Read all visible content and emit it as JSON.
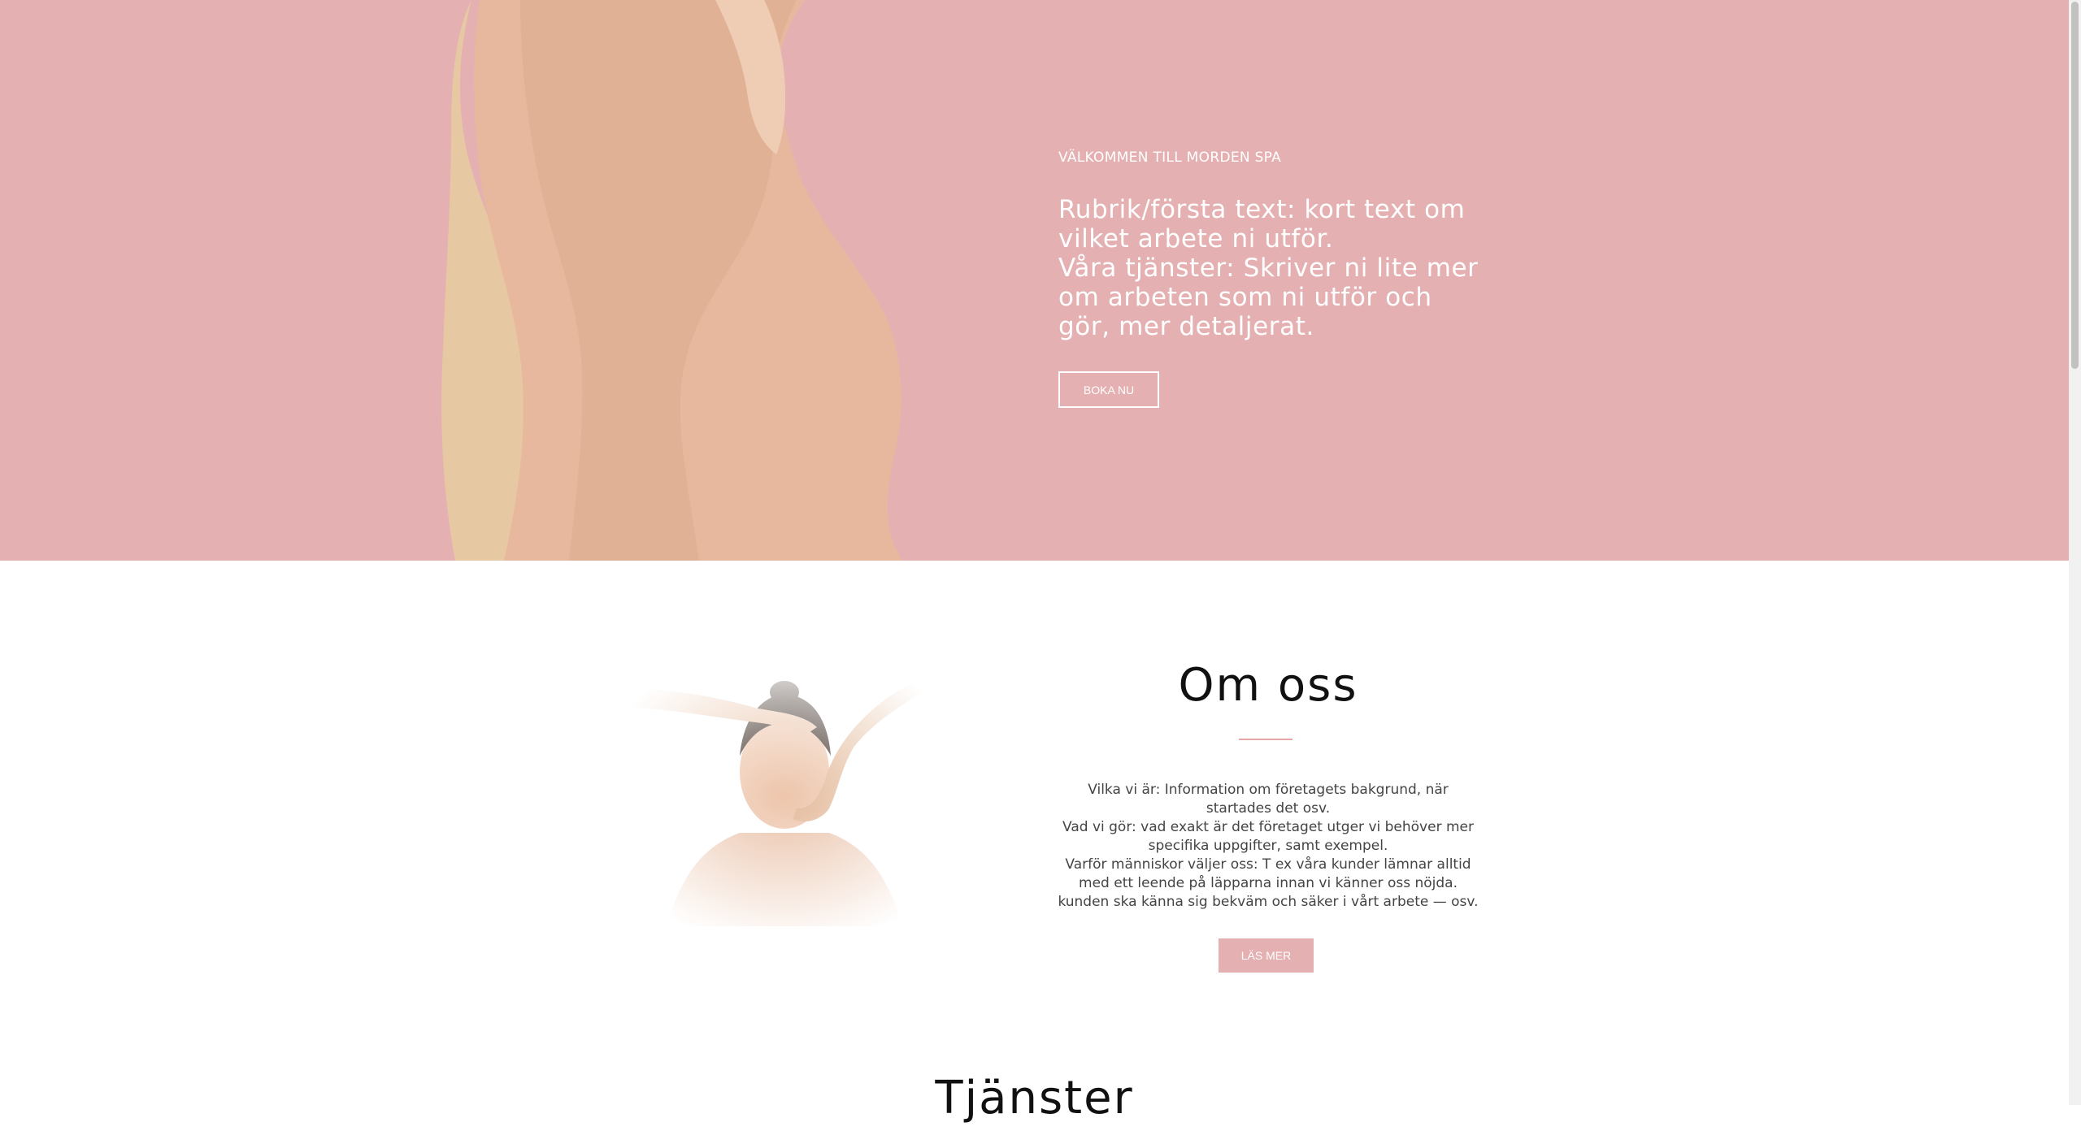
{
  "hero": {
    "welcome": "VÄLKOMMEN TILL MORDEN SPA",
    "lines": [
      "Rubrik/första text: kort text om vilket arbete ni utför.",
      "Våra tjänster: Skriver ni lite mer om arbeten som ni utför och gör, mer detaljerat."
    ],
    "button_label": "BOKA NU"
  },
  "about": {
    "title": "Om oss",
    "paragraphs": [
      "Vilka vi är: Information om företagets bakgrund, när startades det osv.",
      "Vad vi gör: vad exakt är det företaget utger vi behöver mer specifika uppgifter, samt exempel.",
      "Varför människor väljer oss: T ex våra kunder lämnar alltid med ett leende på läpparna innan vi känner oss nöjda. kunden ska känna sig bekväm och säker i vårt arbete — osv."
    ],
    "button_label": "LÄS MER"
  },
  "services": {
    "title": "Tjänster"
  },
  "colors": {
    "hero_bg": "#e5b0b1",
    "accent": "#e5a7a8",
    "text_dark": "#111111",
    "text_body": "#444444"
  }
}
